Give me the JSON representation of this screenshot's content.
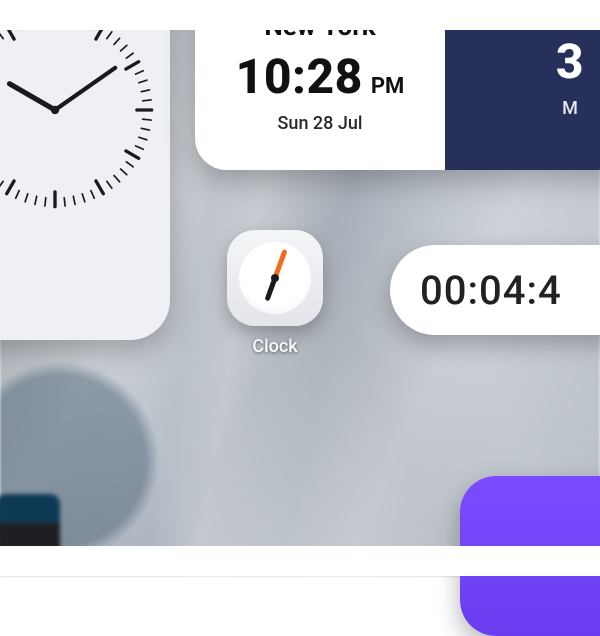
{
  "world_clock": {
    "left": {
      "city": "New York",
      "time": "10:28",
      "ampm": "PM",
      "date": "Sun 28 Jul"
    },
    "right": {
      "city_partial": "",
      "time_partial": "3",
      "date_partial": "M"
    }
  },
  "clock_app": {
    "label": "Clock"
  },
  "timer": {
    "value_partial": "00:04:4"
  },
  "icons": {
    "analog_clock": "analog-clock-icon",
    "clock_app_face": "clock-face-icon"
  }
}
